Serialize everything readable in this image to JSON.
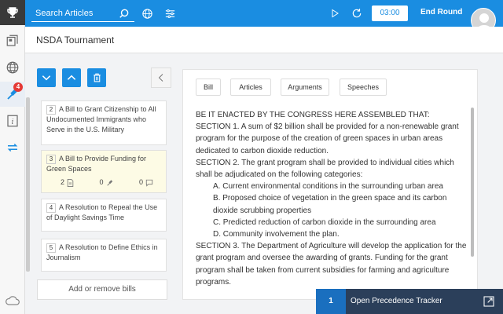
{
  "topbar": {
    "search_placeholder": "Search Articles",
    "timer": "03:00",
    "end_round": "End Round"
  },
  "header": {
    "title": "NSDA Tournament"
  },
  "sidebar": {
    "badge_count": "4"
  },
  "bills": [
    {
      "number": "2",
      "title": "A Bill to Grant Citizenship to All Undocumented Immigrants who Serve in the U.S. Military"
    },
    {
      "number": "3",
      "title": "A Bill to Provide Funding for Green Spaces",
      "stats": {
        "docs": "2",
        "speeches": "0",
        "comments": "0"
      }
    },
    {
      "number": "4",
      "title": "A Resolution to Repeal the Use of Daylight Savings Time"
    },
    {
      "number": "5",
      "title": "A Resolution to Define Ethics in Journalism"
    }
  ],
  "add_remove_label": "Add or remove bills",
  "tabs": [
    "Bill",
    "Articles",
    "Arguments",
    "Speeches"
  ],
  "bill_text": [
    {
      "text": "BE IT ENACTED BY THE CONGRESS HERE ASSEMBLED THAT:",
      "indent": false
    },
    {
      "text": "SECTION 1. A sum of $2 billion shall be provided for a non-renewable grant program for the purpose of the creation of green spaces in urban areas dedicated to carbon dioxide reduction.",
      "indent": false
    },
    {
      "text": "SECTION 2. The grant program shall be provided to individual cities which shall be adjudicated on the following categories:",
      "indent": false
    },
    {
      "text": "A. Current environmental conditions in the surrounding urban area",
      "indent": true
    },
    {
      "text": "B. Proposed choice of vegetation in the green space and its carbon dioxide scrubbing properties",
      "indent": true
    },
    {
      "text": "C. Predicted reduction of carbon dioxide in the surrounding area",
      "indent": true
    },
    {
      "text": "D. Community involvement the plan.",
      "indent": true
    },
    {
      "text": "SECTION 3. The Department of Agriculture will develop the application for the grant program and oversee the awarding of grants. Funding for the grant program shall be taken from current subsidies for farming and agriculture programs.",
      "indent": false
    }
  ],
  "tracker": {
    "count": "1",
    "label": "Open Precedence Tracker"
  },
  "colors": {
    "primary": "#1a8de1",
    "tracker_bg": "#2b3f5a",
    "badge": "#e53935",
    "selected_bill": "#fdfbe5"
  }
}
